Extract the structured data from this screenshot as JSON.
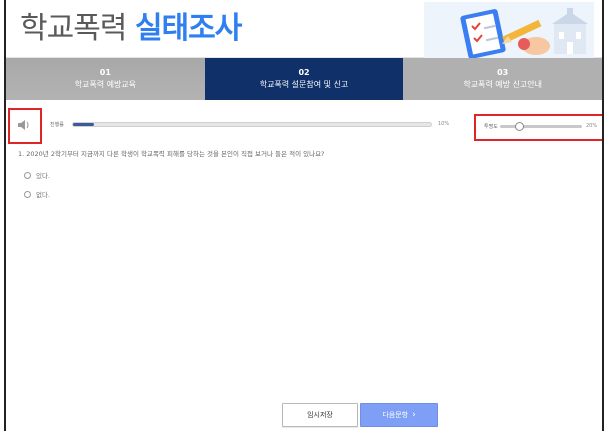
{
  "header": {
    "title_light": "학교폭력",
    "title_bold": "실태조사"
  },
  "steps": [
    {
      "num": "01",
      "label": "학교폭력 예방교육",
      "active": false
    },
    {
      "num": "02",
      "label": "학교폭력 설문참여 및 신고",
      "active": true
    },
    {
      "num": "03",
      "label": "학교폭력 예방 신고안내",
      "active": false
    }
  ],
  "controls": {
    "progress_label": "진행률",
    "progress_value": 0.06,
    "progress_pct_text": "10%",
    "speed_label": "투명도",
    "speed_value": 0.2,
    "speed_pct_text": "20%"
  },
  "question": {
    "text": "1. 2020년 2학기부터 지금까지 다른 학생이 학교폭력 피해를 당하는 것을 본인이 직접 보거나 들은 적이 있나요?",
    "options": [
      "있다.",
      "없다."
    ]
  },
  "buttons": {
    "save": "임시저장",
    "next": "다음문항"
  },
  "colors": {
    "accent": "#2f7ff0",
    "nav_active": "#10306a",
    "nav_inactive": "#b0b0b0",
    "highlight": "#e02525",
    "next_button": "#7e9ff5"
  }
}
